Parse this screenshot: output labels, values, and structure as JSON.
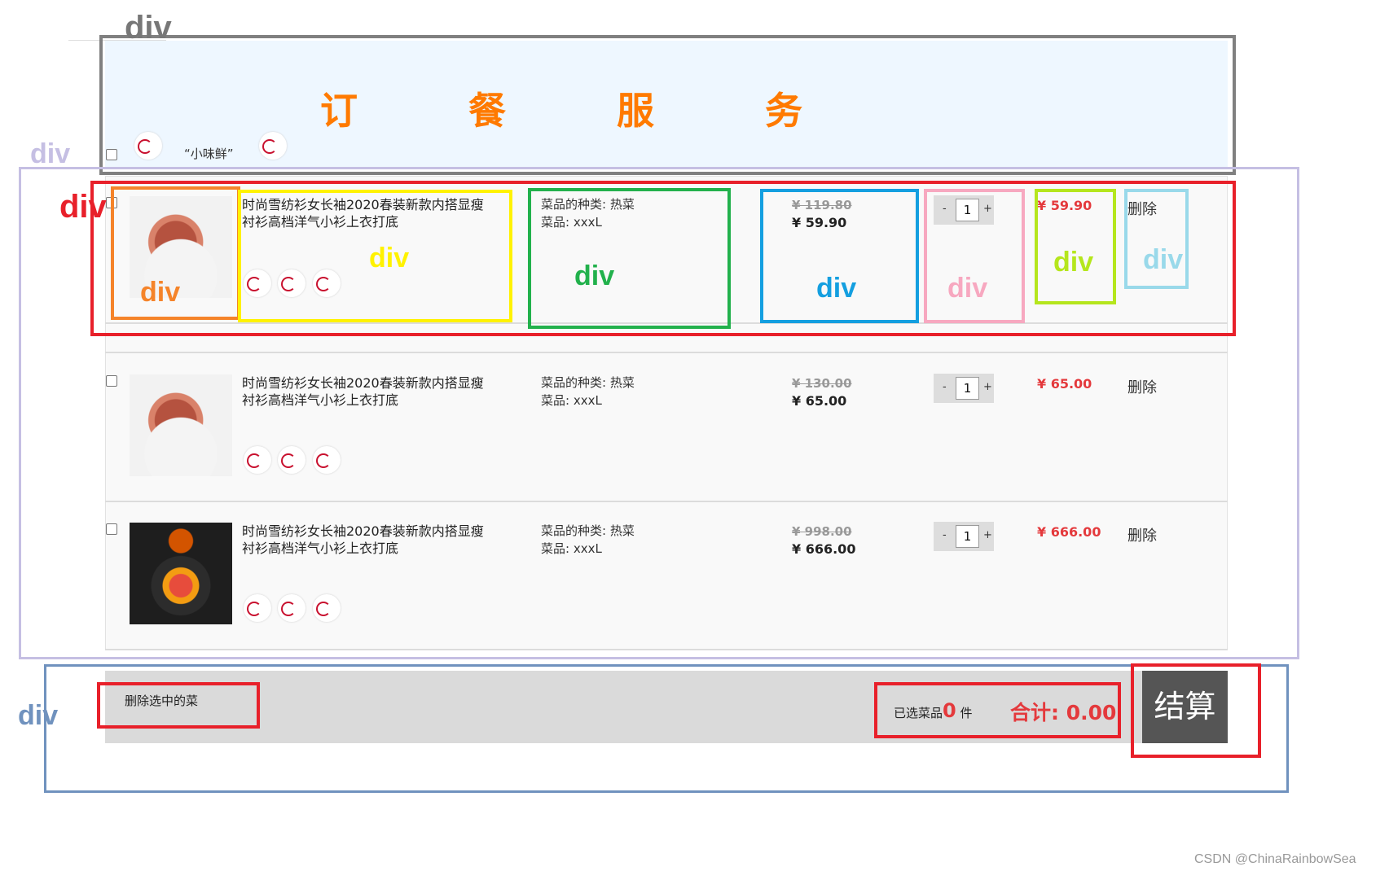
{
  "header": {
    "title": "订 餐 服 务",
    "brand": "“小味鲜”",
    "logo_text": "小味鲜"
  },
  "items": [
    {
      "name": "时尚雪纺衫女长袖2020春装新款内搭显瘦衬衫高档洋气小衫上衣打底",
      "category": "菜品的种类: 热菜",
      "size": "菜品: xxxL",
      "old_price": "¥ 119.80",
      "new_price": "¥ 59.90",
      "quantity": "1",
      "subtotal": "¥ 59.90",
      "delete_label": "删除",
      "image": "ham-dish"
    },
    {
      "name": "时尚雪纺衫女长袖2020春装新款内搭显瘦衬衫高档洋气小衫上衣打底",
      "category": "菜品的种类: 热菜",
      "size": "菜品: xxxL",
      "old_price": "¥ 130.00",
      "new_price": "¥ 65.00",
      "quantity": "1",
      "subtotal": "¥ 65.00",
      "delete_label": "删除",
      "image": "ham-dish"
    },
    {
      "name": "时尚雪纺衫女长袖2020春装新款内搭显瘦衬衫高档洋气小衫上衣打底",
      "category": "菜品的种类: 热菜",
      "size": "菜品: xxxL",
      "old_price": "¥ 998.00",
      "new_price": "¥ 666.00",
      "quantity": "1",
      "subtotal": "¥ 666.00",
      "delete_label": "删除",
      "image": "hotpot-dish"
    }
  ],
  "stepper": {
    "minus": "-",
    "plus": "+"
  },
  "footer": {
    "delete_selected": "删除选中的菜",
    "selected_prefix": "已选菜品",
    "selected_count": "0",
    "selected_suffix": "件",
    "total_label": "合计: 0.00",
    "checkout": "结算"
  },
  "annotation_label": "div",
  "annotation_colors": {
    "page": "#808080",
    "list": "#c5bfe3",
    "row": "#e8202a",
    "image": "#f5842a",
    "name": "#fff200",
    "spec": "#22b14c",
    "price": "#149fe0",
    "quantity": "#f7a8c0",
    "subtotal": "#b5e61d",
    "delete": "#99d9ea",
    "footer": "#7092be",
    "price_red": "#e4393c",
    "title_orange": "#ff7a00"
  },
  "watermark": "CSDN @ChinaRainbowSea"
}
